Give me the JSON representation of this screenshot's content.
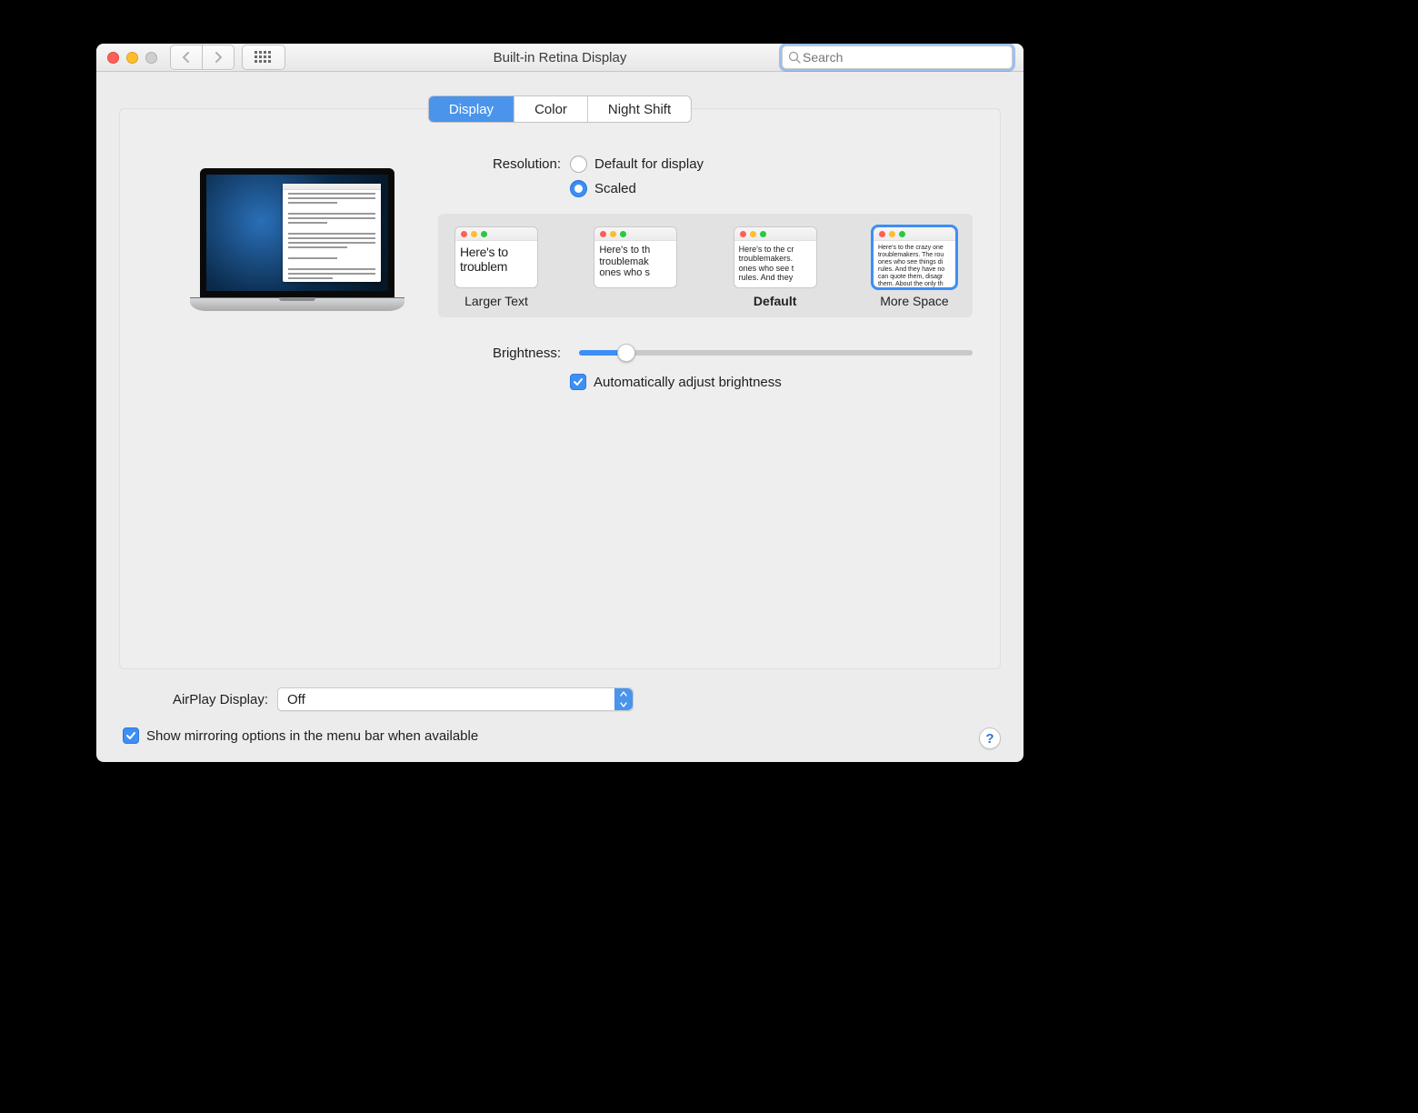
{
  "window": {
    "title": "Built-in Retina Display"
  },
  "search": {
    "placeholder": "Search"
  },
  "tabs": {
    "display": "Display",
    "color": "Color",
    "night_shift": "Night Shift"
  },
  "resolution": {
    "label": "Resolution:",
    "default_opt": "Default for display",
    "scaled_opt": "Scaled",
    "larger_text": "Larger Text",
    "default_label": "Default",
    "more_space": "More Space",
    "thumb_text_1": "Here's to troublem",
    "thumb_text_2": "Here's to th troublemak ones who s",
    "thumb_text_3": "Here's to the cr troublemakers. ones who see t rules. And they",
    "thumb_text_4": "Here's to the crazy one troublemakers. The rou ones who see things di rules. And they have no can quote them, disagr them. About the only th Because they change t"
  },
  "brightness": {
    "label": "Brightness:",
    "auto_label": "Automatically adjust brightness"
  },
  "airplay": {
    "label": "AirPlay Display:",
    "value": "Off"
  },
  "mirroring": {
    "label": "Show mirroring options in the menu bar when available"
  },
  "help": {
    "label": "?"
  }
}
